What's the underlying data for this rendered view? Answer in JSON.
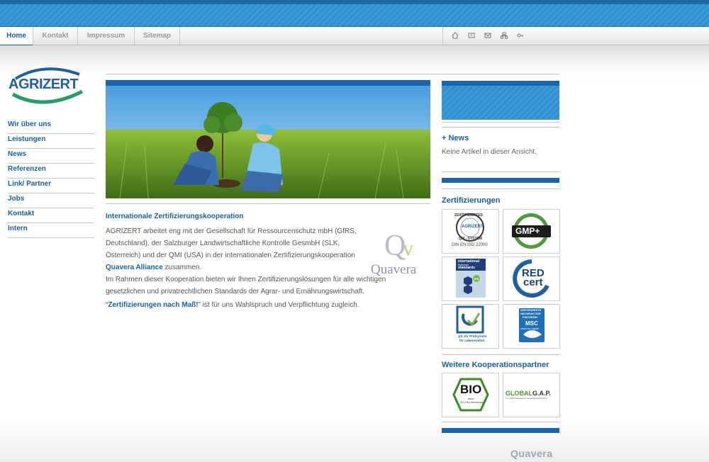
{
  "nav": {
    "tabs": [
      {
        "label": "Home"
      },
      {
        "label": "Kontakt"
      },
      {
        "label": "Impressum"
      },
      {
        "label": "Sitemap"
      }
    ],
    "icons": [
      "home-icon",
      "print-icon",
      "mail-icon",
      "sitemap-icon",
      "key-icon"
    ]
  },
  "logo": {
    "text": "AGRIZERT"
  },
  "sidebar": {
    "items": [
      {
        "label": "Wir über uns"
      },
      {
        "label": "Leistungen"
      },
      {
        "label": "News"
      },
      {
        "label": "Referenzen"
      },
      {
        "label": "Link/ Partner"
      },
      {
        "label": "Jobs"
      },
      {
        "label": "Kontakt"
      },
      {
        "label": "Intern"
      }
    ]
  },
  "article": {
    "title": "Internationale Zertifizierungskooperation",
    "p1_text": "AGRIZERT arbeitet eng mit der Gesellschaft für Ressourcenschutz mbH (GfRS, Deutschland), der Salzburger Landwirtschaftliche Kontrolle GesmbH (SLK, Österreich) und der QMI (USA) in der internationalen Zertifizierungskooperation",
    "p1_link": "Quavera Alliance",
    "p1_tail": " zusammen.",
    "p2_text": "Im Rahmen dieser Kooperation bieten wir Ihnen Zertifizierungslösungen für alle wichtigen gesetzlichen und privatrechtlichen Standards der Agrar- und Ernährungswirtschaft.",
    "p3_quote_open": "“",
    "p3_link": "Zertifizierungen nach Maß!",
    "p3_tail": "” ist für uns Wahlspruch und Verpflichtung zugleich.",
    "partner_logo_text": "Quavera"
  },
  "news": {
    "heading": "+ News",
    "empty_text": "Keine Artikel in dieser Ansicht."
  },
  "certifications": {
    "heading": "Zertifizierungen",
    "tiles": [
      {
        "name": "agrizert-qm-system",
        "line1": "ZERTIFIZIERTES",
        "line2": "AGRIZERT",
        "line3": "QM - SYSTEM",
        "line4": "DIN EN ISO 22000"
      },
      {
        "name": "gmp-plus",
        "line1": "GMP+"
      },
      {
        "name": "ifs-standards",
        "line1": "international",
        "line2": "featured",
        "line3": "standards",
        "line4": "IFS"
      },
      {
        "name": "red-cert",
        "line1": "RED",
        "line2": "cert"
      },
      {
        "name": "qs",
        "line1": "QS",
        "line2": "QS. Ihr Prüfsystem",
        "line3": "für Lebensmittel."
      },
      {
        "name": "msc",
        "line1": "ZERTIFIZIERTE",
        "line2": "NACHHALTIGE",
        "line3": "FISCHEREI",
        "line4": "MSC",
        "line5": "www.msc.org/de"
      }
    ]
  },
  "partners": {
    "heading": "Weitere Kooperationspartner",
    "tiles": [
      {
        "name": "bio-siegel",
        "line1": "BIO",
        "line2": "nach",
        "line3": "EG-Öko-Verordnung"
      },
      {
        "name": "globalgap",
        "line1": "GLOBAL",
        "line2": "G.A.P.",
        "line3": "The Global Partnership for Good Agricultural Practice"
      }
    ]
  },
  "footer": {
    "logo": "Quavera"
  },
  "colors": {
    "accent": "#1a5f9e",
    "band": "#3c9ad8",
    "bar": "#1565ac"
  }
}
